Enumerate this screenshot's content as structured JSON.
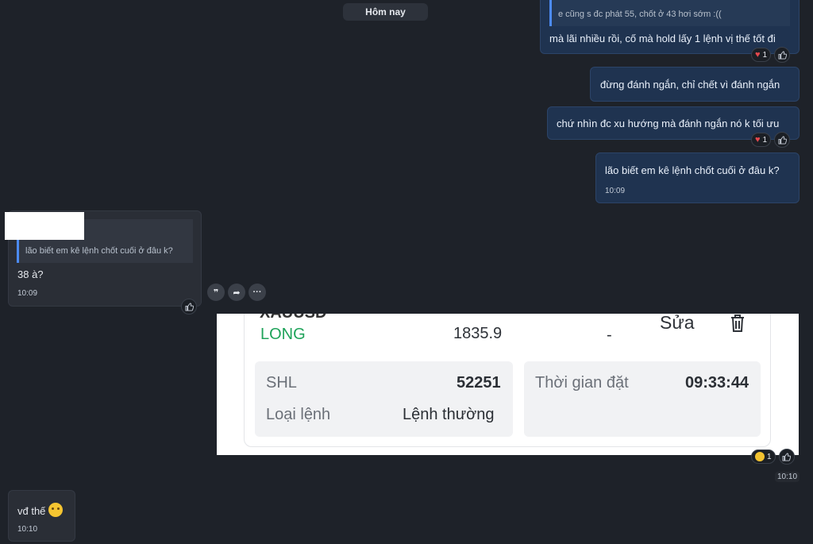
{
  "date_divider": "Hôm nay",
  "messages": {
    "m1": {
      "quote": "e cũng s đc phát 55, chốt ở 43 hơi sớm :((",
      "text": "mà lãi nhiều rồi, cố mà hold lấy 1 lệnh vị thế tốt đi",
      "reaction_count": "1"
    },
    "m2": {
      "text": "đừng đánh ngắn, chỉ chết vì đánh ngắn"
    },
    "m3": {
      "text": "chứ nhìn đc xu hướng mà đánh ngắn nó k tối ưu",
      "reaction_count": "1"
    },
    "m4": {
      "text": "lão biết em kê lệnh chốt cuối ở đâu k?",
      "time": "10:09"
    },
    "m5": {
      "quote": "lão biết em kê lệnh chốt cuối ở đâu k?",
      "text": "38 à?",
      "time": "10:09"
    },
    "m6": {
      "reaction_count": "1",
      "time": "10:10",
      "order": {
        "header_cut": "XAUUSD",
        "side": "LONG",
        "price": "1835.9",
        "dash": "-",
        "edit_label": "Sửa",
        "shl_label": "SHL",
        "shl_value": "52251",
        "type_label": "Loại lệnh",
        "type_value": "Lệnh thường",
        "time_label": "Thời gian đặt",
        "time_value": "09:33:44"
      }
    },
    "m7": {
      "text": "vđ thế",
      "time": "10:10"
    }
  },
  "colors": {
    "background": "#1e2229",
    "outgoing_bubble": "#1f3350",
    "incoming_bubble": "#2a2e36",
    "quote_bar": "#4c8bf5",
    "long_green": "#1fa35a",
    "heart": "#e5484d"
  }
}
